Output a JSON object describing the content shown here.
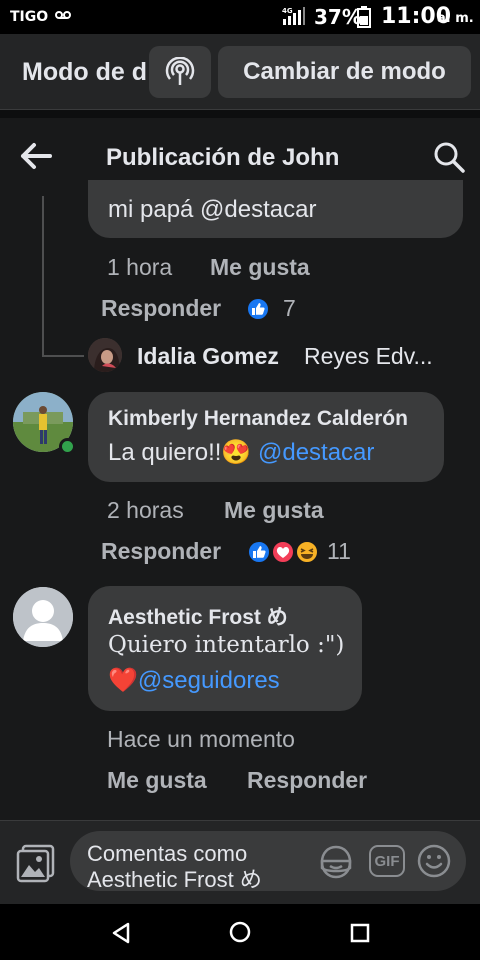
{
  "status_bar": {
    "carrier": "TIGO",
    "network": "4G",
    "battery": "37%",
    "time": "11:00",
    "ampm": "a. m."
  },
  "mode_bar": {
    "title": "Modo de d",
    "switch_label": "Cambiar de modo"
  },
  "header": {
    "title": "Publicación de John"
  },
  "comments": [
    {
      "text": "mi papá @destacar",
      "time": "1 hora",
      "like_label": "Me gusta",
      "reply_label": "Responder",
      "reaction_count": "7"
    },
    {
      "author": "Idalia Gomez",
      "snippet": "Reyes Edv..."
    },
    {
      "author": "Kimberly Hernandez Calderón",
      "text": "La quiero!!",
      "emoji": "😍",
      "mention": "@destacar",
      "time": "2 horas",
      "like_label": "Me gusta",
      "reply_label": "Responder",
      "reaction_count": "11"
    },
    {
      "author": "Aesthetic Frost め",
      "text": "Quiero intentarlo :\")",
      "emoji": "❤️",
      "mention": "@seguidores",
      "time": "Hace un momento",
      "like_label": "Me gusta",
      "reply_label": "Responder"
    }
  ],
  "composer": {
    "placeholder": "Comentas como Aesthetic Frost め",
    "gif_label": "GIF"
  },
  "icons": {
    "back": "arrow-left-icon",
    "search": "search-icon",
    "mode": "broadcast-icon",
    "gallery": "gallery-icon",
    "sticker": "sticker-icon",
    "emoji": "emoji-icon"
  },
  "colors": {
    "background": "#18191a",
    "bubble": "#3a3b3c",
    "mention": "#4599ff",
    "like": "#1877f2",
    "love": "#f33e58",
    "online": "#31a24c"
  }
}
